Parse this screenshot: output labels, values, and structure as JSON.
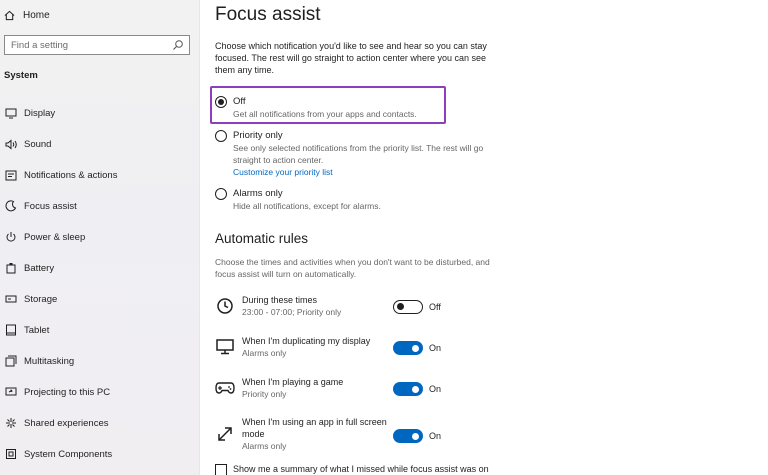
{
  "sidebar": {
    "home": "Home",
    "search_placeholder": "Find a setting",
    "section": "System",
    "items": [
      {
        "label": "Display",
        "icon": "display-icon"
      },
      {
        "label": "Sound",
        "icon": "sound-icon"
      },
      {
        "label": "Notifications & actions",
        "icon": "notifications-icon"
      },
      {
        "label": "Focus assist",
        "icon": "focus-assist-icon"
      },
      {
        "label": "Power & sleep",
        "icon": "power-icon"
      },
      {
        "label": "Battery",
        "icon": "battery-icon"
      },
      {
        "label": "Storage",
        "icon": "storage-icon"
      },
      {
        "label": "Tablet",
        "icon": "tablet-icon"
      },
      {
        "label": "Multitasking",
        "icon": "multitasking-icon"
      },
      {
        "label": "Projecting to this PC",
        "icon": "projecting-icon"
      },
      {
        "label": "Shared experiences",
        "icon": "shared-experiences-icon"
      },
      {
        "label": "System Components",
        "icon": "system-components-icon"
      }
    ]
  },
  "main": {
    "title": "Focus assist",
    "description": "Choose which notification you'd like to see and hear so you can stay focused. The rest will go straight to action center where you can see them any time.",
    "options": [
      {
        "label": "Off",
        "sub": "Get all notifications from your apps and contacts.",
        "checked": true
      },
      {
        "label": "Priority only",
        "sub": "See only selected notifications from the priority list. The rest will go straight to action center.",
        "link": "Customize your priority list",
        "checked": false
      },
      {
        "label": "Alarms only",
        "sub": "Hide all notifications, except for alarms.",
        "checked": false
      }
    ],
    "rules_title": "Automatic rules",
    "rules_description": "Choose the times and activities when you don't want to be disturbed, and focus assist will turn on automatically.",
    "rules": [
      {
        "name": "During these times",
        "sub": "23:00 - 07:00; Priority only",
        "state": "Off",
        "on": false,
        "icon": "clock-icon"
      },
      {
        "name": "When I'm duplicating my display",
        "sub": "Alarms only",
        "state": "On",
        "on": true,
        "icon": "monitor-icon"
      },
      {
        "name": "When I'm playing a game",
        "sub": "Priority only",
        "state": "On",
        "on": true,
        "icon": "gamepad-icon"
      },
      {
        "name": "When I'm using an app in full screen mode",
        "sub": "Alarms only",
        "state": "On",
        "on": true,
        "icon": "fullscreen-icon"
      }
    ],
    "summary_checkbox": "Show me a summary of what I missed while focus assist was on"
  },
  "colors": {
    "accent": "#0067c0",
    "highlight": "#8b3fbf"
  }
}
